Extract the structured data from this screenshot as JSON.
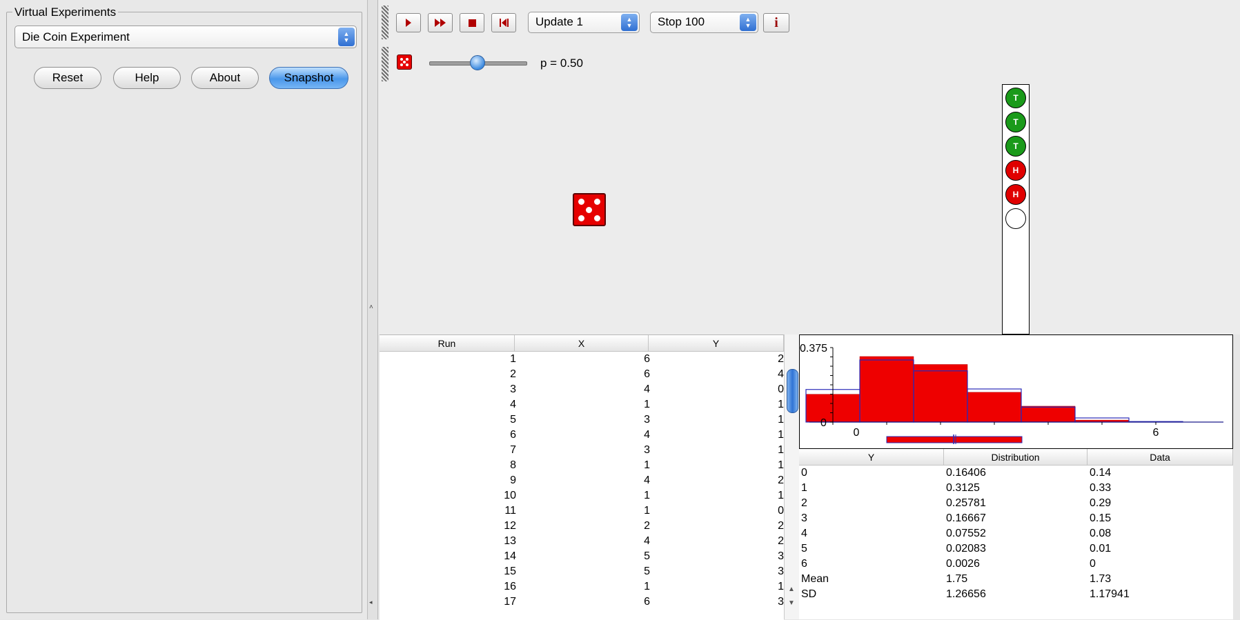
{
  "left_panel": {
    "group_title": "Virtual Experiments",
    "selected_experiment": "Die Coin Experiment",
    "buttons": {
      "reset": "Reset",
      "help": "Help",
      "about": "About",
      "snapshot": "Snapshot"
    }
  },
  "toolbar": {
    "update_select": "Update 1",
    "stop_select": "Stop 100",
    "info_label": "i"
  },
  "controls": {
    "p_label": "p = 0.50",
    "p_value": 0.5
  },
  "experiment": {
    "die_value": 5,
    "coins": [
      "T",
      "T",
      "T",
      "H",
      "H",
      ""
    ],
    "coin_colors": {
      "T": "#1a9a1a",
      "H": "#e00000"
    }
  },
  "run_table": {
    "headers": [
      "Run",
      "X",
      "Y"
    ],
    "rows": [
      [
        "1",
        "6",
        "2"
      ],
      [
        "2",
        "6",
        "4"
      ],
      [
        "3",
        "4",
        "0"
      ],
      [
        "4",
        "1",
        "1"
      ],
      [
        "5",
        "3",
        "1"
      ],
      [
        "6",
        "4",
        "1"
      ],
      [
        "7",
        "3",
        "1"
      ],
      [
        "8",
        "1",
        "1"
      ],
      [
        "9",
        "4",
        "2"
      ],
      [
        "10",
        "1",
        "1"
      ],
      [
        "11",
        "1",
        "0"
      ],
      [
        "12",
        "2",
        "2"
      ],
      [
        "13",
        "4",
        "2"
      ],
      [
        "14",
        "5",
        "3"
      ],
      [
        "15",
        "5",
        "3"
      ],
      [
        "16",
        "1",
        "1"
      ],
      [
        "17",
        "6",
        "3"
      ]
    ]
  },
  "chart_data": {
    "type": "bar",
    "y_tick_label": "0.375",
    "y_zero_label": "0",
    "x_tick_labels": [
      "0",
      "6"
    ],
    "categories": [
      "0",
      "1",
      "2",
      "3",
      "4",
      "5",
      "6"
    ],
    "series": [
      {
        "name": "Distribution",
        "values": [
          0.16406,
          0.3125,
          0.25781,
          0.16667,
          0.07552,
          0.02083,
          0.0026
        ]
      },
      {
        "name": "Data",
        "values": [
          0.14,
          0.33,
          0.29,
          0.15,
          0.08,
          0.01,
          0
        ]
      }
    ],
    "ylim": [
      0,
      0.375
    ],
    "colors": {
      "data_fill": "#ee0000",
      "distribution_outline": "#2a2ab8"
    }
  },
  "dist_table": {
    "headers": [
      "Y",
      "Distribution",
      "Data"
    ],
    "rows": [
      [
        "0",
        "0.16406",
        "0.14"
      ],
      [
        "1",
        "0.3125",
        "0.33"
      ],
      [
        "2",
        "0.25781",
        "0.29"
      ],
      [
        "3",
        "0.16667",
        "0.15"
      ],
      [
        "4",
        "0.07552",
        "0.08"
      ],
      [
        "5",
        "0.02083",
        "0.01"
      ],
      [
        "6",
        "0.0026",
        "0"
      ],
      [
        "Mean",
        "1.75",
        "1.73"
      ],
      [
        "SD",
        "1.26656",
        "1.17941"
      ]
    ]
  }
}
